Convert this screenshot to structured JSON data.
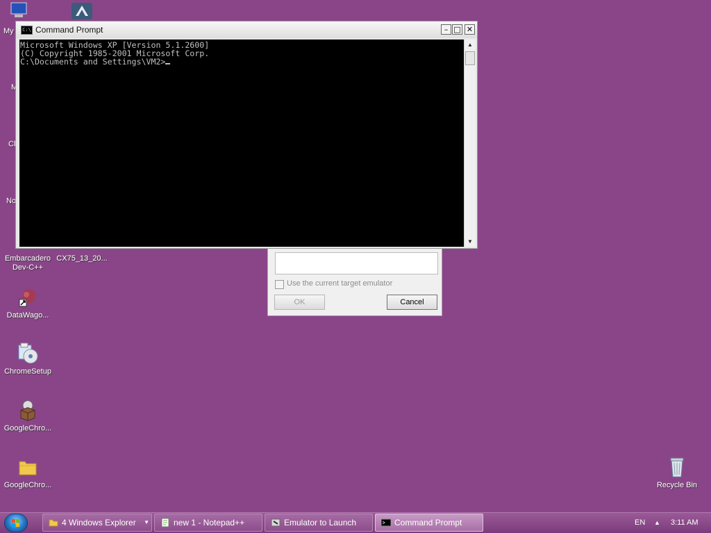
{
  "desktop": {
    "icons": [
      {
        "label": "My",
        "icon": "my-computer-icon"
      },
      {
        "label": "",
        "icon": "app-shortcut-icon"
      },
      {
        "label": "M",
        "icon": "partial-icon"
      },
      {
        "label": "Cl",
        "icon": "partial-icon"
      },
      {
        "label": "No",
        "icon": "partial-icon"
      },
      {
        "label": "Embarcadero Dev-C++",
        "icon": "devcpp-icon"
      },
      {
        "label": "CX75_13_20...",
        "icon": "cx75-icon"
      },
      {
        "label": "DataWago...",
        "icon": "datawagon-icon"
      },
      {
        "label": "ChromeSetup",
        "icon": "installer-icon"
      },
      {
        "label": "GoogleChro...",
        "icon": "package-icon"
      },
      {
        "label": "GoogleChro...",
        "icon": "folder-icon"
      },
      {
        "label": "Recycle Bin",
        "icon": "recycle-bin-icon"
      }
    ]
  },
  "dialog": {
    "checkbox_label": "Use the current target emulator",
    "checkbox_checked": false,
    "ok_label": "OK",
    "cancel_label": "Cancel"
  },
  "cmd_window": {
    "title": "Command Prompt",
    "icon_text": "C:\\",
    "lines": [
      "Microsoft Windows XP [Version 5.1.2600]",
      "(C) Copyright 1985-2001 Microsoft Corp.",
      "",
      "C:\\Documents and Settings\\VM2>"
    ],
    "controls": {
      "minimize": "–",
      "maximize": "□",
      "close": "✕"
    }
  },
  "taskbar": {
    "items": [
      {
        "label": "4 Windows Explorer",
        "icon": "folder-icon"
      },
      {
        "label": "new 1 - Notepad++",
        "icon": "notepadpp-icon"
      },
      {
        "label": "Emulator to Launch",
        "icon": "tool-icon"
      },
      {
        "label": "Command Prompt",
        "icon": "cmd-icon",
        "active": true
      }
    ],
    "language": "EN",
    "tray_arrow": "▲",
    "clock": "3:11 AM"
  },
  "colors": {
    "desktop": "#8a4589",
    "console_bg": "#000000",
    "console_text": "#c0c0c0"
  }
}
